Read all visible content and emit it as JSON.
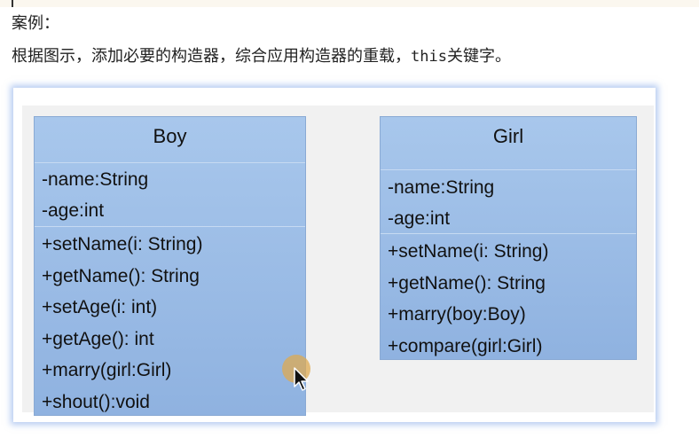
{
  "heading": "案例：",
  "instruction": {
    "before": "根据图示，添加必要的构造器，综合应用构造器的重载，",
    "code": "this",
    "after": "关键字。"
  },
  "uml": {
    "boy": {
      "name": "Boy",
      "attributes": [
        "-name:String",
        "-age:int"
      ],
      "operations": [
        "+setName(i: String)",
        "+getName(): String",
        "+setAge(i: int)",
        "+getAge(): int",
        "+marry(girl:Girl)",
        "+shout():void"
      ]
    },
    "girl": {
      "name": "Girl",
      "attributes": [
        "-name:String",
        "-age:int"
      ],
      "operations": [
        "+setName(i: String)",
        "+getName(): String",
        "+marry(boy:Boy)",
        "+compare(girl:Girl)"
      ]
    }
  },
  "colors": {
    "class_fill_top": "#a8c7ec",
    "class_fill_bottom": "#8fb2e0",
    "figure_glow": "#78a0e6",
    "cursor_halo": "#deaa50"
  },
  "icons": {
    "cursor": "arrow-cursor-icon"
  }
}
